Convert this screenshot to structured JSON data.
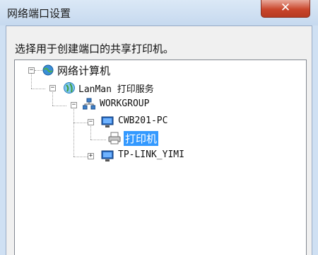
{
  "window": {
    "title": "网络端口设置",
    "close_glyph": "✕"
  },
  "instruction": "选择用于创建端口的共享打印机。",
  "tree": {
    "root": {
      "label": "网络计算机",
      "expander": "−"
    },
    "lanman": {
      "label": "LanMan 打印服务",
      "expander": "−"
    },
    "workgroup": {
      "label": "WORKGROUP",
      "expander": "−"
    },
    "pc1": {
      "label": "CWB201-PC",
      "expander": "−"
    },
    "printer": {
      "label": "打印机"
    },
    "pc2": {
      "label": "TP-LINK_YIMI",
      "expander": "+"
    }
  },
  "colors": {
    "selection": "#3399ff"
  }
}
